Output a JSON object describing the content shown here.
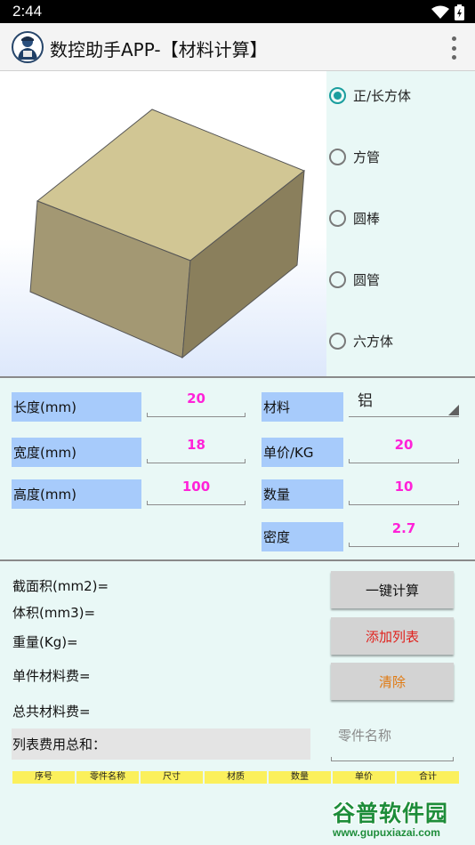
{
  "status": {
    "time": "2:44"
  },
  "appbar": {
    "title": "数控助手APP-【材料计算】"
  },
  "shapes": [
    {
      "label": "正/长方体",
      "selected": true
    },
    {
      "label": "方管",
      "selected": false
    },
    {
      "label": "圆棒",
      "selected": false
    },
    {
      "label": "圆管",
      "selected": false
    },
    {
      "label": "六方体",
      "selected": false
    }
  ],
  "dims": {
    "length": {
      "label": "长度(mm)",
      "value": "20"
    },
    "width": {
      "label": "宽度(mm)",
      "value": "18"
    },
    "height": {
      "label": "高度(mm)",
      "value": "100"
    }
  },
  "material": {
    "material": {
      "label": "材料",
      "value": "铝"
    },
    "price": {
      "label": "单价/KG",
      "value": "20"
    },
    "qty": {
      "label": "数量",
      "value": "10"
    },
    "density": {
      "label": "密度",
      "value": "2.7"
    }
  },
  "results": {
    "area": "截面积(mm2)=",
    "volume": "体积(mm3)=",
    "weight": "重量(Kg)=",
    "unit_cost": "单件材料费=",
    "total_cost": "总共材料费=",
    "list_total": "列表费用总和："
  },
  "buttons": {
    "calc": "一键计算",
    "add": "添加列表",
    "clear": "清除"
  },
  "part_name": {
    "placeholder": "零件名称",
    "value": ""
  },
  "table": {
    "headers": [
      "序号",
      "零件名称",
      "尺寸",
      "材质",
      "数量",
      "单价",
      "合计"
    ]
  },
  "watermark": {
    "title": "谷普软件园",
    "url": "www.gupuxiazai.com"
  },
  "colors": {
    "label_bg": "#a7cbfb",
    "value_text": "#ff22d8",
    "add_button_text": "#e0221e",
    "clear_button_text": "#e07a12",
    "radio_accent": "#1a9e9e",
    "table_header_bg": "#fbf05c"
  }
}
